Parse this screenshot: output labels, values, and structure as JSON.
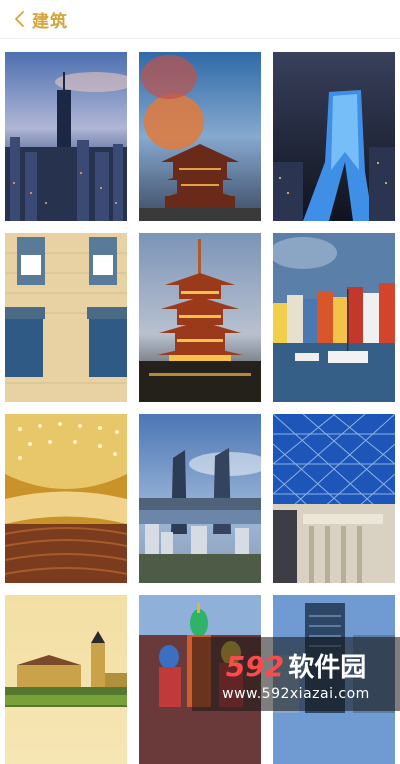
{
  "header": {
    "title": "建筑",
    "back_icon": "chevron-left-icon"
  },
  "colors": {
    "accent": "#d4a53c",
    "watermark_red": "#ff4a4a"
  },
  "gallery": {
    "items": [
      "city-tower-sunset",
      "pagoda-orange-clouds",
      "blue-glass-tower-night",
      "yellow-facade-windows",
      "golden-pagoda-lit",
      "colorful-harbor-houses",
      "concert-hall-interior",
      "twin-towers-coast",
      "glass-dome-roof",
      "palace-yellow-sky",
      "onion-dome-church",
      "city-skyscraper-blue"
    ]
  },
  "watermark": {
    "brand_number": "592",
    "brand_text": "软件园",
    "url": "www.592xiazai.com"
  }
}
